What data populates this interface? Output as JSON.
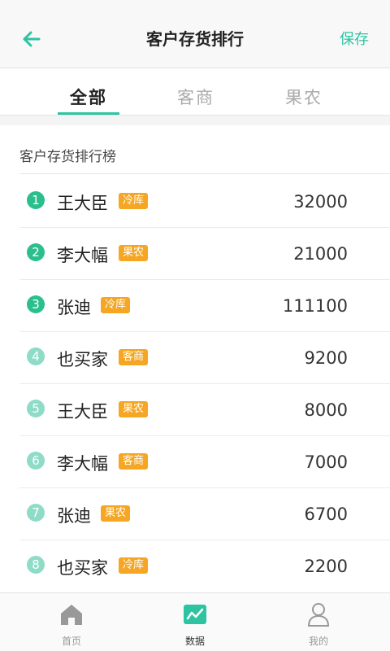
{
  "header": {
    "title": "客户存货排行",
    "save_label": "保存"
  },
  "tabs": [
    {
      "label": "全部",
      "active": true
    },
    {
      "label": "客商",
      "active": false
    },
    {
      "label": "果农",
      "active": false
    }
  ],
  "ranking": {
    "title": "客户存货排行榜",
    "rows": [
      {
        "rank": "1",
        "name": "王大臣",
        "tag": "冷库",
        "value": "32000"
      },
      {
        "rank": "2",
        "name": "李大幅",
        "tag": "果农",
        "value": "21000"
      },
      {
        "rank": "3",
        "name": "张迪",
        "tag": "冷库",
        "value": "111100"
      },
      {
        "rank": "4",
        "name": "也买家",
        "tag": "客商",
        "value": "9200"
      },
      {
        "rank": "5",
        "name": "王大臣",
        "tag": "果农",
        "value": "8000"
      },
      {
        "rank": "6",
        "name": "李大幅",
        "tag": "客商",
        "value": "7000"
      },
      {
        "rank": "7",
        "name": "张迪",
        "tag": "果农",
        "value": "6700"
      },
      {
        "rank": "8",
        "name": "也买家",
        "tag": "冷库",
        "value": "2200"
      }
    ]
  },
  "tabbar": [
    {
      "label": "首页",
      "icon": "home-icon"
    },
    {
      "label": "数据",
      "icon": "chart-icon"
    },
    {
      "label": "我的",
      "icon": "user-icon"
    }
  ],
  "colors": {
    "accent": "#2ec4a2",
    "badge": "#f5a623",
    "rank_top": "#2bbf8e",
    "rank_low": "#8edcc8"
  }
}
